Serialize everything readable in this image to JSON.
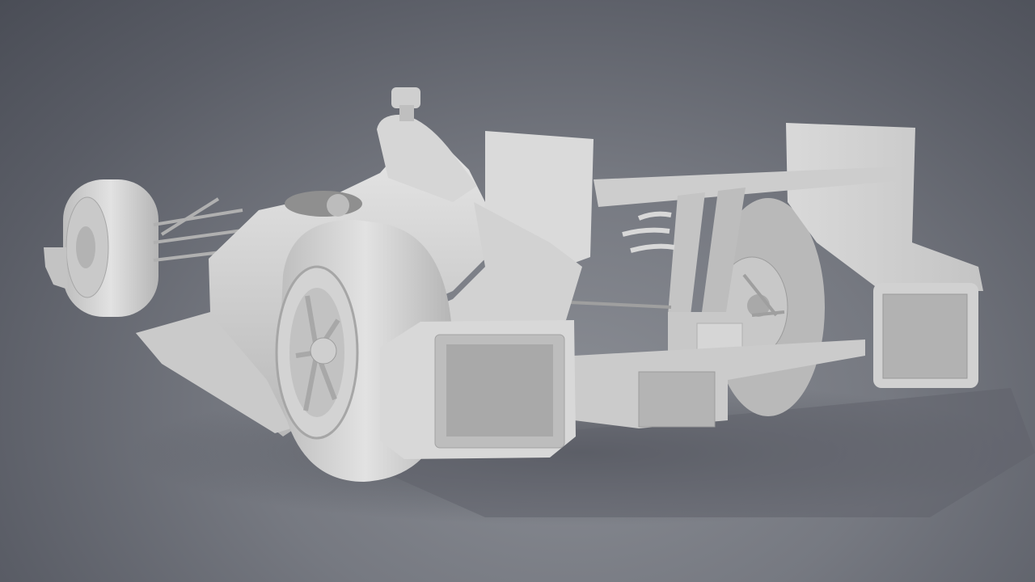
{
  "scene": {
    "subject": "race-car-clay-render",
    "colors": {
      "background_light": "#8a8d94",
      "background_dark": "#4a4d56",
      "body": "#d4d4d4",
      "body_shadow": "#a9a9a9",
      "body_highlight": "#ececec",
      "ground_shadow": "#5c5f66"
    }
  }
}
